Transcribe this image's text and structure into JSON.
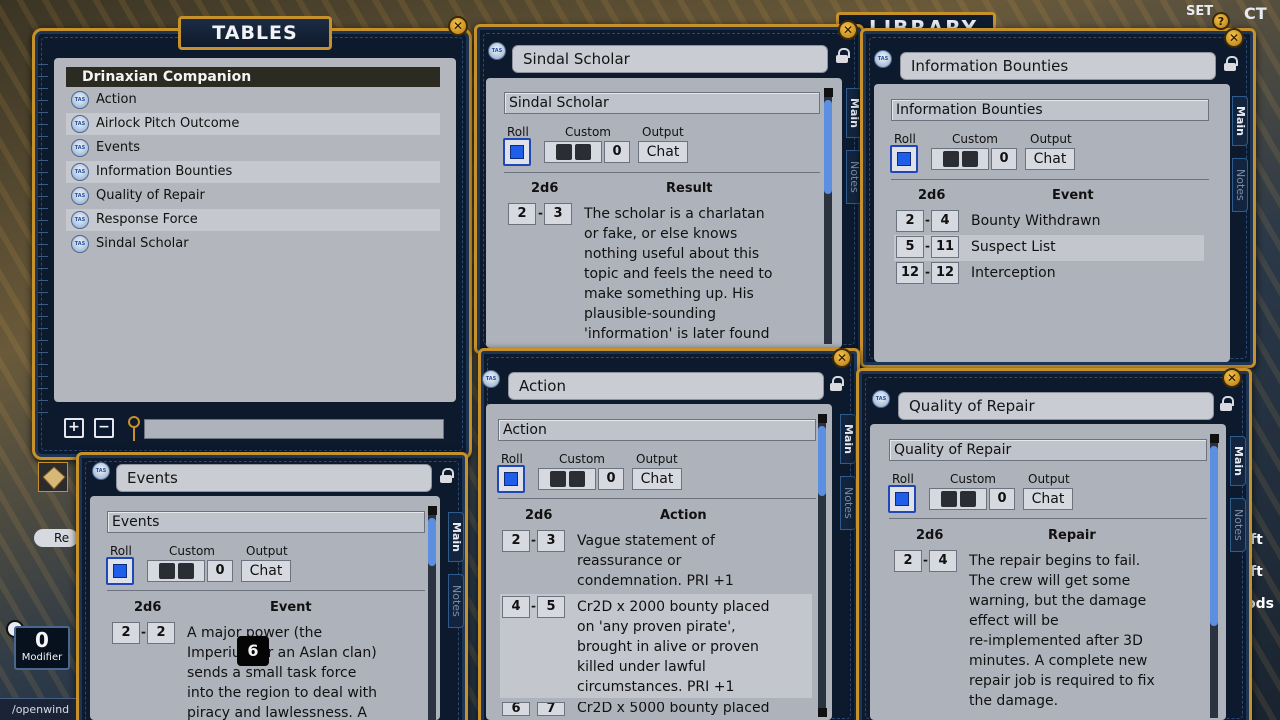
{
  "library": {
    "title": "LIBRARY",
    "top_right_labels": [
      "SET",
      "CT"
    ],
    "side_fragments": [
      "ft",
      "ft",
      "ods"
    ]
  },
  "tables_window": {
    "title": "TABLES",
    "group": "Drinaxian Companion",
    "items": [
      "Action",
      "Airlock Pitch Outcome",
      "Events",
      "Information Bounties",
      "Quality of Repair",
      "Response Force",
      "Sindal Scholar"
    ],
    "add_label": "+",
    "remove_label": "−"
  },
  "modifier": {
    "value": "0",
    "label": "Modifier"
  },
  "dice_tooltip": "6",
  "bottom_path": "/openwind",
  "reset_fragment": "Re",
  "controls": {
    "roll": "Roll",
    "custom": "Custom",
    "output": "Output",
    "chat": "Chat",
    "zero": "0",
    "tab_main": "Main",
    "tab_notes": "Notes",
    "dice_col": "2d6",
    "tas": "TAS"
  },
  "sindal": {
    "title": "Sindal Scholar",
    "subtitle": "Sindal Scholar",
    "col": "Result",
    "rows": [
      {
        "from": "2",
        "to": "3",
        "text": [
          "The scholar is a charlatan",
          "or fake, or else knows",
          "nothing useful about this",
          "topic and feels the need to",
          "make something up. His",
          "plausible-sounding",
          "'information' is later found"
        ]
      }
    ]
  },
  "info": {
    "title": "Information Bounties",
    "subtitle": "Information Bounties",
    "col": "Event",
    "rows": [
      {
        "from": "2",
        "to": "4",
        "text": "Bounty Withdrawn"
      },
      {
        "from": "5",
        "to": "11",
        "text": "Suspect List"
      },
      {
        "from": "12",
        "to": "12",
        "text": "Interception"
      }
    ]
  },
  "action": {
    "title": "Action",
    "subtitle": "Action",
    "col": "Action",
    "rows": [
      {
        "from": "2",
        "to": "3",
        "text": [
          "Vague statement of",
          "reassurance or",
          "condemnation. PRI +1"
        ]
      },
      {
        "from": "4",
        "to": "5",
        "text": [
          "Cr2D x 2000 bounty placed",
          "on 'any proven pirate',",
          "brought in alive or proven",
          "killed under lawful",
          "circumstances. PRI +1"
        ]
      },
      {
        "from": "6",
        "to": "7",
        "text": [
          "Cr2D x 5000 bounty placed"
        ]
      }
    ]
  },
  "repair": {
    "title": "Quality of Repair",
    "subtitle": "Quality of Repair",
    "col": "Repair",
    "rows": [
      {
        "from": "2",
        "to": "4",
        "text": [
          "The repair begins to fail.",
          "The crew will get some",
          "warning, but the damage",
          "effect will be",
          "re-implemented after 3D",
          "minutes. A complete new",
          "repair job is required to fix",
          "the damage."
        ]
      }
    ]
  },
  "events": {
    "title": "Events",
    "subtitle": "Events",
    "col": "Event",
    "rows": [
      {
        "from": "2",
        "to": "2",
        "text": [
          "A major power (the",
          "Imperium or an Aslan clan)",
          "sends a small task force",
          "into the region to deal with",
          "piracy and lawlessness. A"
        ]
      }
    ]
  }
}
